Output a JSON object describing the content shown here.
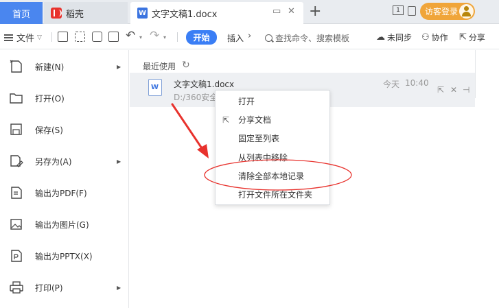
{
  "titlebar": {
    "tab_home": "首页",
    "tab_daoke": "稻壳",
    "tab_doc": "文字文稿1.docx",
    "window_number": "1",
    "guest_login": "访客登录",
    "colors": {
      "home_tab": "#4a86ef",
      "guest_button": "#f0a53a"
    }
  },
  "toolbar": {
    "file_menu": "文件",
    "start_tab": "开始",
    "insert_tab": "插入",
    "search_placeholder": "查找命令、搜索模板",
    "unsynced": "未同步",
    "collaborate": "协作",
    "share": "分享",
    "colors": {
      "start_tab": "#3a7ef5"
    }
  },
  "file_menu": {
    "items": [
      {
        "label": "新建(N)",
        "icon": "new-file-icon",
        "has_submenu": true
      },
      {
        "label": "打开(O)",
        "icon": "folder-open-icon",
        "has_submenu": false
      },
      {
        "label": "保存(S)",
        "icon": "save-icon",
        "has_submenu": false
      },
      {
        "label": "另存为(A)",
        "icon": "save-as-icon",
        "has_submenu": true
      },
      {
        "label": "输出为PDF(F)",
        "icon": "export-pdf-icon",
        "has_submenu": false
      },
      {
        "label": "输出为图片(G)",
        "icon": "export-image-icon",
        "has_submenu": false
      },
      {
        "label": "输出为PPTX(X)",
        "icon": "export-pptx-icon",
        "has_submenu": false
      },
      {
        "label": "打印(P)",
        "icon": "print-icon",
        "has_submenu": true
      }
    ]
  },
  "recent": {
    "title": "最近使用",
    "files": [
      {
        "name": "文字文稿1.docx",
        "path": "D:/360安全",
        "date": "今天",
        "time": "10:40"
      }
    ]
  },
  "context_menu": {
    "items": [
      {
        "label": "打开"
      },
      {
        "label": "分享文档",
        "icon": "share-icon"
      },
      {
        "label": "固定至列表"
      },
      {
        "label": "从列表中移除"
      },
      {
        "label": "清除全部本地记录",
        "highlighted": true
      },
      {
        "label": "打开文件所在文件夹"
      }
    ]
  },
  "annotation": {
    "color": "#e8322d"
  }
}
